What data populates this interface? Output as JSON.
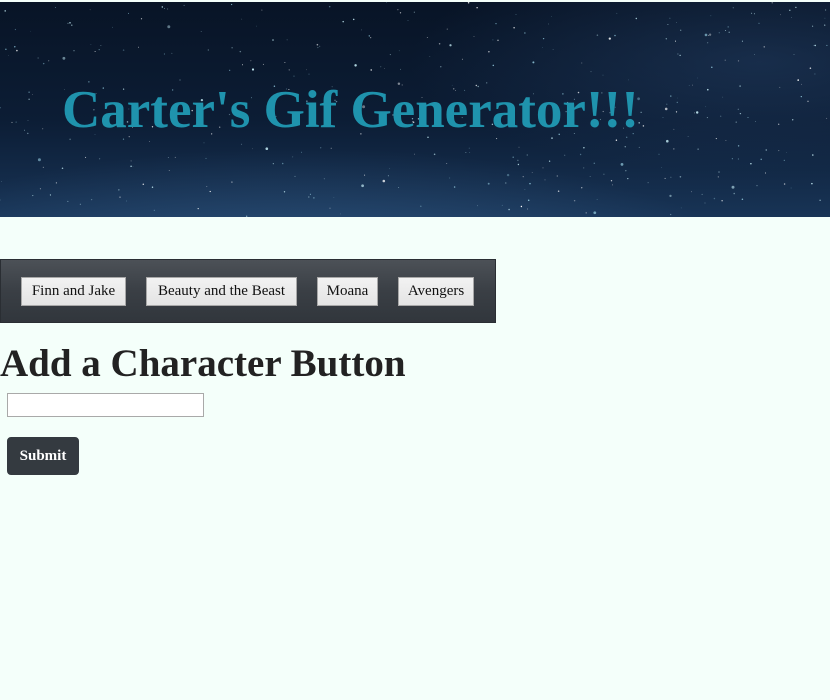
{
  "header": {
    "title": "Carter's Gif Generator!!!",
    "title_color": "#1f93ad",
    "background": "starry-night-sky"
  },
  "character_buttons": [
    {
      "label": "Finn and Jake"
    },
    {
      "label": "Beauty and the Beast"
    },
    {
      "label": "Moana"
    },
    {
      "label": "Avengers"
    }
  ],
  "add_form": {
    "heading": "Add a Character Button",
    "input_value": "",
    "input_placeholder": "",
    "submit_label": "Submit"
  },
  "colors": {
    "page_background": "#f4fffa",
    "button_bar": "#3a3f45",
    "submit_button": "#343a40"
  }
}
